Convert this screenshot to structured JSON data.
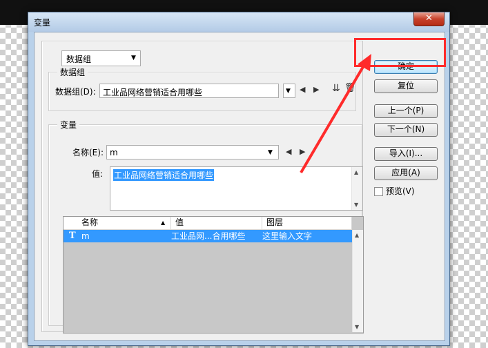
{
  "dialog": {
    "title": "变量",
    "close_glyph": "✕"
  },
  "top_select": {
    "value": "数据组"
  },
  "dataset_group": {
    "label": "数据组",
    "field_label": "数据组(D):",
    "field_value": "工业品网络营销适合用哪些"
  },
  "variable_group": {
    "label": "变量",
    "name_label": "名称(E):",
    "name_value": "m",
    "value_label": "值:",
    "value_text": "工业品网络营销适合用哪些"
  },
  "table": {
    "columns": [
      "名称",
      "值",
      "图层"
    ],
    "rows": [
      {
        "icon": "T",
        "name": "m",
        "value": "工业品网...合用哪些",
        "layer": "这里输入文字"
      }
    ]
  },
  "buttons": {
    "ok": "确定",
    "reset": "复位",
    "prev": "上一个(P)",
    "next": "下一个(N)",
    "import": "导入(I)...",
    "apply": "应用(A)"
  },
  "preview_checkbox": {
    "label": "预览(V)",
    "checked": false
  },
  "icons": [
    "dropdown-arrow-icon",
    "prev-triangle-icon",
    "next-triangle-icon",
    "import-dataset-icon",
    "delete-trash-icon",
    "sort-up-icon",
    "text-layer-icon"
  ],
  "colors": {
    "selection": "#3399ff",
    "annotation": "#ff2b2b",
    "titlebar": "#b9d1ea"
  }
}
